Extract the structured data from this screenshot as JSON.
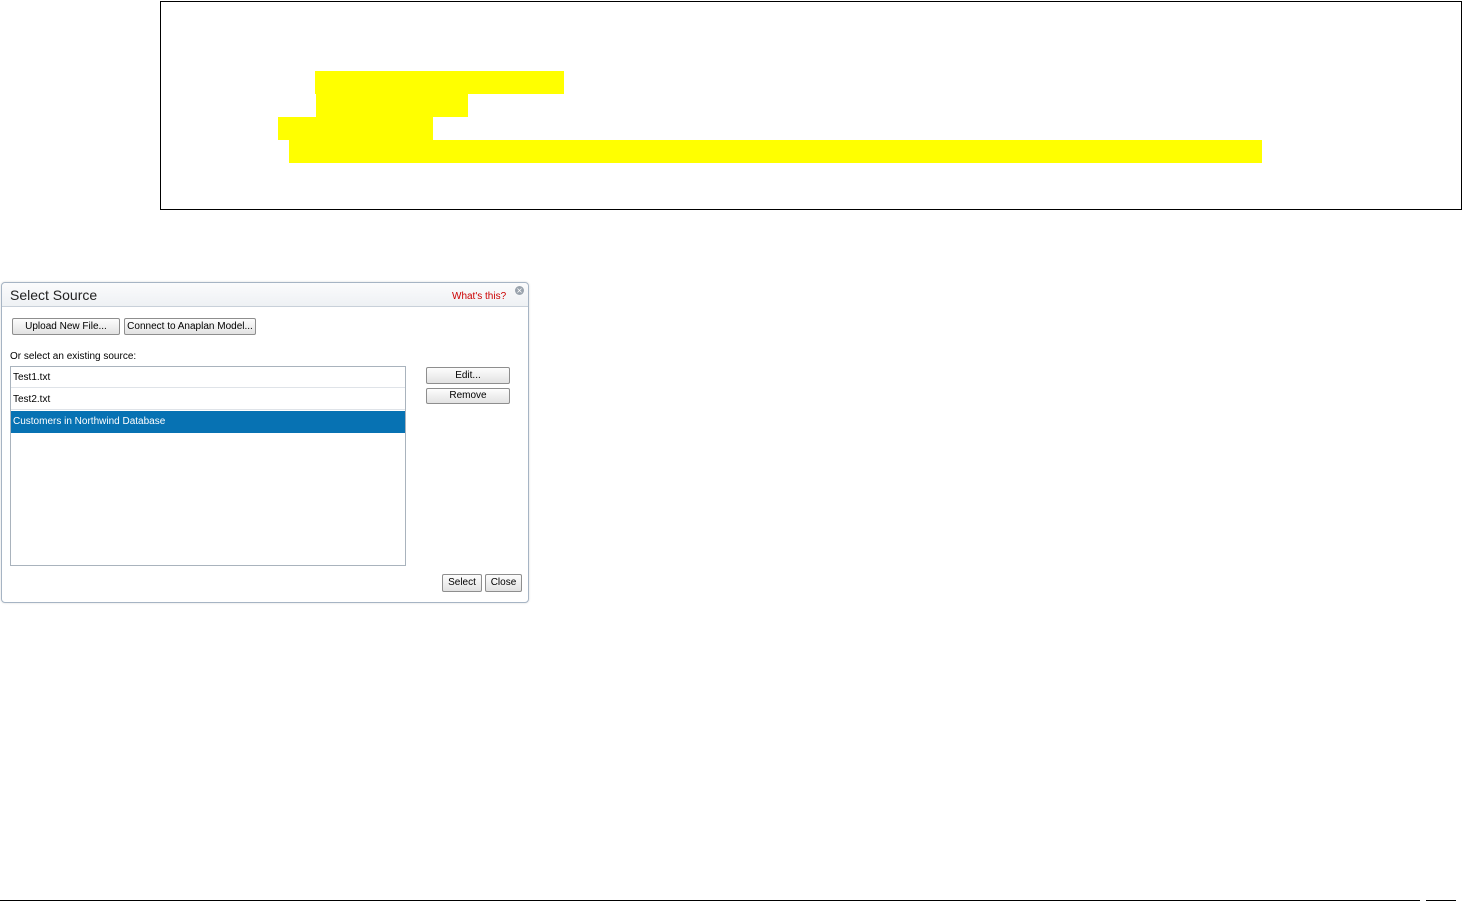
{
  "document": {
    "highlight_color": "#ffff00"
  },
  "dialog": {
    "title": "Select Source",
    "help_link": "What's this?",
    "close_glyph": "×",
    "toolbar": {
      "upload_label": "Upload New File...",
      "connect_label": "Connect to Anaplan Model..."
    },
    "existing_label": "Or select an existing source:",
    "sources": [
      "Test1.txt",
      "Test2.txt",
      "Customers in Northwind Database"
    ],
    "selected_source": "Customers in Northwind Database",
    "side_buttons": {
      "edit_label": "Edit...",
      "remove_label": "Remove"
    },
    "footer": {
      "select_label": "Select",
      "close_label": "Close"
    },
    "colors": {
      "selection": "#0772b3",
      "help_link": "#cc0000"
    }
  }
}
